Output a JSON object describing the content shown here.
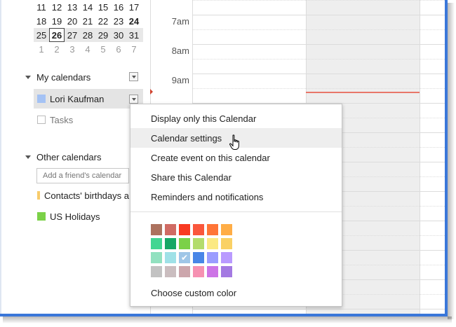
{
  "mini_calendar": {
    "rows": [
      [
        {
          "d": "11"
        },
        {
          "d": "12"
        },
        {
          "d": "13"
        },
        {
          "d": "14"
        },
        {
          "d": "15"
        },
        {
          "d": "16"
        },
        {
          "d": "17"
        }
      ],
      [
        {
          "d": "18"
        },
        {
          "d": "19"
        },
        {
          "d": "20"
        },
        {
          "d": "21"
        },
        {
          "d": "22"
        },
        {
          "d": "23"
        },
        {
          "d": "24",
          "bold": true
        }
      ],
      [
        {
          "d": "25"
        },
        {
          "d": "26",
          "today": true
        },
        {
          "d": "27"
        },
        {
          "d": "28"
        },
        {
          "d": "29"
        },
        {
          "d": "30"
        },
        {
          "d": "31"
        }
      ],
      [
        {
          "d": "1",
          "dim": true
        },
        {
          "d": "2",
          "dim": true
        },
        {
          "d": "3",
          "dim": true
        },
        {
          "d": "4",
          "dim": true
        },
        {
          "d": "5",
          "dim": true
        },
        {
          "d": "6",
          "dim": true
        },
        {
          "d": "7",
          "dim": true
        }
      ]
    ]
  },
  "sidebar": {
    "my_calendars": {
      "label": "My calendars",
      "items": [
        {
          "label": "Lori Kaufman",
          "color": "#a4c2f4",
          "selected": true
        },
        {
          "label": "Tasks",
          "color": "",
          "selected": false
        }
      ]
    },
    "other_calendars": {
      "label": "Other calendars",
      "input_placeholder": "Add a friend's calendar",
      "items": [
        {
          "label": "Contacts' birthdays a",
          "color": "#f8cc6b"
        },
        {
          "label": "US Holidays",
          "color": "#7bd148"
        }
      ]
    }
  },
  "grid": {
    "times": [
      "7am",
      "8am",
      "9am"
    ]
  },
  "menu": {
    "items": [
      {
        "label": "Display only this Calendar",
        "hover": false
      },
      {
        "label": "Calendar settings",
        "hover": true
      },
      {
        "label": "Create event on this calendar",
        "hover": false
      },
      {
        "label": "Share this Calendar",
        "hover": false
      },
      {
        "label": "Reminders and notifications",
        "hover": false
      }
    ],
    "palette": [
      [
        "#ac725e",
        "#d06b64",
        "#f83a22",
        "#fa573c",
        "#ff7537",
        "#ffad46"
      ],
      [
        "#42d692",
        "#16a765",
        "#7bd148",
        "#b3dc6c",
        "#fbe983",
        "#fad165"
      ],
      [
        "#92e1c0",
        "#9fe1e7",
        "#9fc6e7",
        "#4986e7",
        "#9a9cff",
        "#b99aff"
      ],
      [
        "#c2c2c2",
        "#cabdbf",
        "#cca6ac",
        "#f691b2",
        "#cd74e6",
        "#a47ae2"
      ]
    ],
    "selected_color": "#9fc6e7",
    "custom_color_label": "Choose custom color"
  },
  "accent": "#3a77d9",
  "now_line_color": "#e8776a"
}
